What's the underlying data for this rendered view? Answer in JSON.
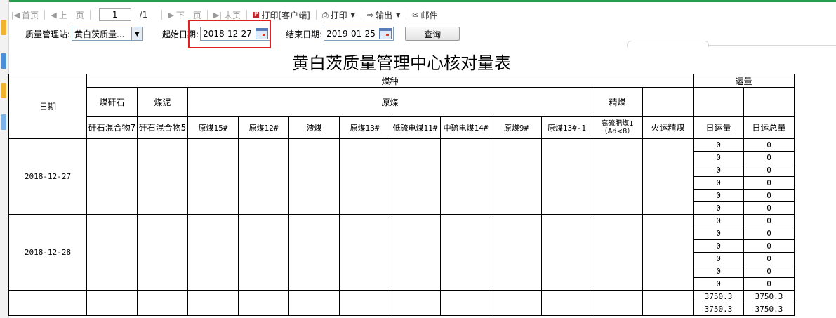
{
  "toolbar": {
    "first": "首页",
    "prev": "上一页",
    "page_value": "1",
    "page_total": "/1",
    "next": "下一页",
    "last": "末页",
    "print_client": "打印[客户端]",
    "print": "打印",
    "export": "输出",
    "mail": "邮件"
  },
  "filters": {
    "station_label": "质量管理站:",
    "station_value": "黄白茨质量...",
    "start_label": "起始日期:",
    "start_value": "2018-12-27",
    "end_label": "结束日期:",
    "end_value": "2019-01-25",
    "query_label": "查询"
  },
  "report": {
    "title": "黄白茨质量管理中心核对量表",
    "header": {
      "date": "日期",
      "coal_type": "煤种",
      "volume": "运量",
      "gangue": "煤矸石",
      "slime": "煤泥",
      "raw": "原煤",
      "clean": "精煤",
      "cols": [
        "矸石混合物7",
        "矸石混合物5",
        "原煤15#",
        "原煤12#",
        "渣煤",
        "原煤13#",
        "低硫电煤11#",
        "中硫电煤14#",
        "原煤9#",
        "原煤13#-1",
        "高硫肥煤1（Ad<8）",
        "火运精煤",
        "日运量",
        "日运总量"
      ]
    },
    "groups": [
      {
        "date": "2018-12-27",
        "rows": [
          [
            "0",
            "0"
          ],
          [
            "0",
            "0"
          ],
          [
            "0",
            "0"
          ],
          [
            "0",
            "0"
          ],
          [
            "0",
            "0"
          ],
          [
            "0",
            "0"
          ]
        ]
      },
      {
        "date": "2018-12-28",
        "rows": [
          [
            "0",
            "0"
          ],
          [
            "0",
            "0"
          ],
          [
            "0",
            "0"
          ],
          [
            "0",
            "0"
          ],
          [
            "0",
            "0"
          ],
          [
            "0",
            "0"
          ]
        ]
      },
      {
        "date": "",
        "rows": [
          [
            "3750.3",
            "3750.3"
          ],
          [
            "3750.3",
            "3750.3"
          ]
        ]
      }
    ]
  }
}
